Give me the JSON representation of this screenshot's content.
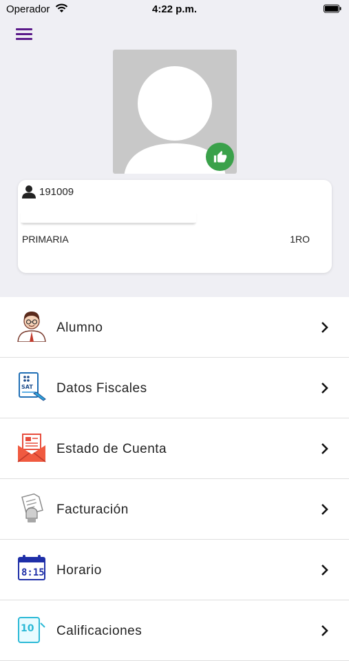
{
  "status_bar": {
    "carrier": "Operador",
    "time": "4:22 p.m."
  },
  "profile": {
    "user_id": "191009",
    "name": "",
    "level": "PRIMARIA",
    "grade": "1RO"
  },
  "menu": [
    {
      "label": "Alumno",
      "icon": "student-icon"
    },
    {
      "label": "Datos Fiscales",
      "icon": "fiscal-data-icon"
    },
    {
      "label": "Estado de Cuenta",
      "icon": "account-statement-icon"
    },
    {
      "label": "Facturación",
      "icon": "invoice-icon"
    },
    {
      "label": "Horario",
      "icon": "schedule-icon"
    },
    {
      "label": "Calificaciones",
      "icon": "grades-icon"
    }
  ],
  "colors": {
    "accent": "#5b1a8a",
    "badge": "#3aa14a",
    "background": "#efeff4"
  }
}
